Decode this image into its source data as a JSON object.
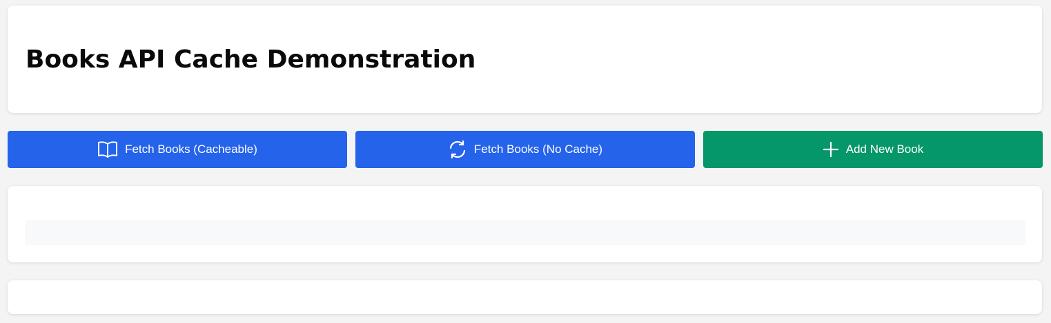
{
  "header": {
    "title": "Books API Cache Demonstration"
  },
  "actions": {
    "fetch_cacheable_label": "Fetch Books (Cacheable)",
    "fetch_no_cache_label": "Fetch Books (No Cache)",
    "add_book_label": "Add New Book",
    "icons": [
      "book-open-icon",
      "refresh-icon",
      "plus-icon"
    ]
  },
  "colors": {
    "primary": "#2563eb",
    "success": "#059669",
    "background": "#f4f4f4",
    "card": "#ffffff"
  }
}
